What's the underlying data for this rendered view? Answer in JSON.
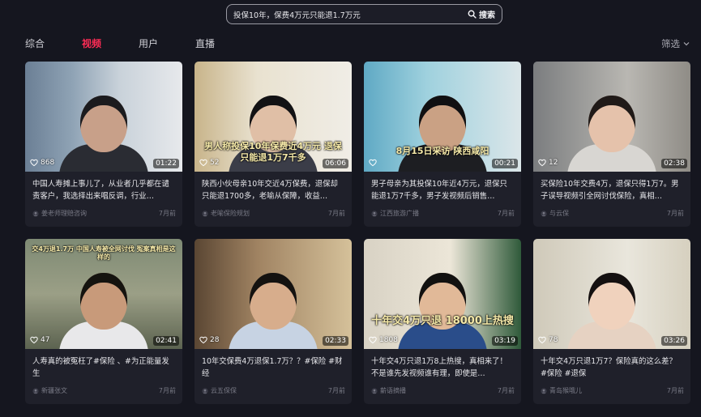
{
  "search": {
    "value": "投保10年，保费4万元只能退1.7万元",
    "button_label": "搜索"
  },
  "tabs": [
    {
      "label": "综合",
      "active": false
    },
    {
      "label": "视频",
      "active": true
    },
    {
      "label": "用户",
      "active": false
    },
    {
      "label": "直播",
      "active": false
    }
  ],
  "filter_label": "筛选",
  "colors": {
    "accent": "#fe2c55",
    "background": "#15161f",
    "card": "#1f202a"
  },
  "videos": [
    {
      "likes": "868",
      "duration": "01:22",
      "title": "中国人寿摊上事儿了，从业者几乎都在谴责客户，我选择出来唱反调，行业…",
      "author": "姜老师理赔咨询",
      "time": "7月前"
    },
    {
      "likes": "52",
      "duration": "06:06",
      "title": "陕西小伙母亲10年交近4万保费，退保却只能退1700多，老喻从保障，收益…",
      "author": "老喻保险规划",
      "time": "7月前",
      "overlay": "男人称投保10年保费近4万元 退保只能退1万7千多"
    },
    {
      "likes": "",
      "duration": "00:21",
      "title": "男子母亲为其投保10年近4万元，退保只能退1万7千多，男子发视频后销售…",
      "author": "江西旅游广播",
      "time": "7月前",
      "overlay": "8月15日采访 陕西咸阳"
    },
    {
      "likes": "12",
      "duration": "02:38",
      "title": "买保险10年交费4万，退保只得1万7。男子误导视频引全网讨伐保险，真相…",
      "author": "与云保",
      "time": "7月前"
    },
    {
      "likes": "47",
      "duration": "02:41",
      "title": "人寿真的被冤枉了#保险 、#为正能量发生",
      "author": "新疆张文",
      "time": "7月前",
      "overlay": "交4万退1.7万 中国人寿被全网讨伐 冤案真相是这样的"
    },
    {
      "likes": "28",
      "duration": "02:33",
      "title": "10年交保费4万退保1.7万？？#保险 #财经",
      "author": "云五保保",
      "time": "7月前"
    },
    {
      "likes": "1808",
      "duration": "03:19",
      "title": "十年交4万只退1万8上热搜，真相来了！不是谁先发视频谁有理，即使是…",
      "author": "薪语摘播",
      "time": "7月前",
      "overlay": "十年交4万只退 18000上热搜"
    },
    {
      "likes": "78",
      "duration": "03:26",
      "title": "十年交4万只退1万7？保险真的这么差？ #保险 #退保",
      "author": "青岛猴哦儿",
      "time": "7月前"
    }
  ]
}
